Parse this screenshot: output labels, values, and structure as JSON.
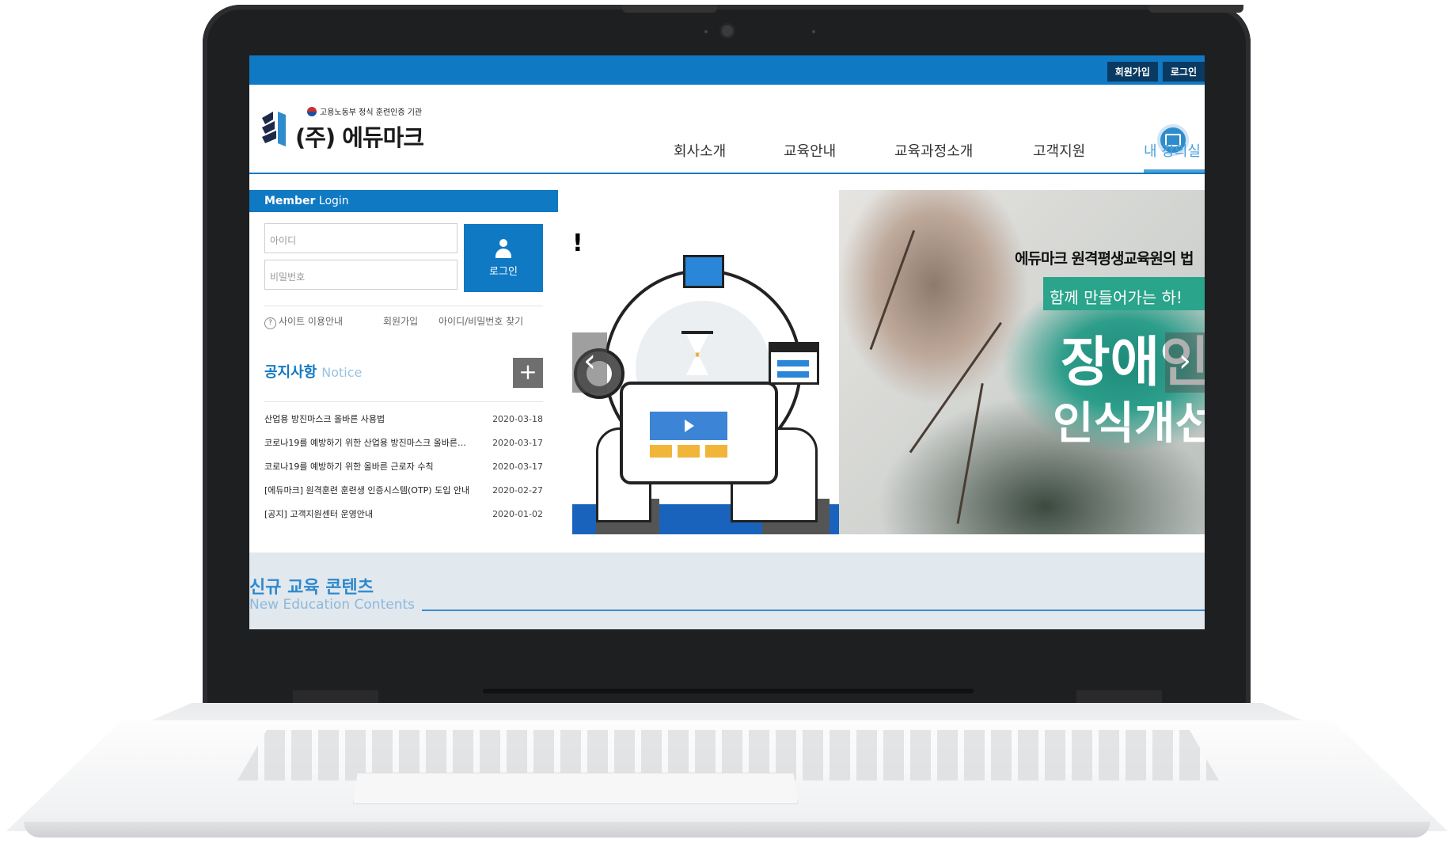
{
  "colors": {
    "brand_blue": "#1079c3",
    "accent_light": "#4aa0dc",
    "dark_navy": "#0a3a62"
  },
  "topbar": {
    "signup": "회원가입",
    "login": "로그인"
  },
  "logo": {
    "subtitle": "고용노동부 정식 훈련인증 기관",
    "name": "(주) 에듀마크"
  },
  "nav": {
    "items": [
      "회사소개",
      "교육안내",
      "교육과정소개",
      "고객지원",
      "내 강의실"
    ],
    "active_index": 4,
    "monitor_icon": "monitor-icon"
  },
  "login": {
    "title_bold": "Member",
    "title_rest": "Login",
    "id_placeholder": "아이디",
    "pw_placeholder": "비밀번호",
    "button": "로그인",
    "links": {
      "guide": "사이트 이용안내",
      "signup": "회원가입",
      "find": "아이디/비밀번호 찾기"
    }
  },
  "notice": {
    "title": "공지사항",
    "title_en": "Notice",
    "more_icon": "plus-icon",
    "items": [
      {
        "title": "산업용 방진마스크 올바른 사용법",
        "date": "2020-03-18"
      },
      {
        "title": "코로나19를 예방하기 위한 산업용 방진마스크 올바른…",
        "date": "2020-03-17"
      },
      {
        "title": "코로나19를 예방하기 위한 올바른 근로자 수칙",
        "date": "2020-03-17"
      },
      {
        "title": "[에듀마크] 원격훈련 훈련생 인증시스템(OTP) 도입 안내",
        "date": "2020-02-27"
      },
      {
        "title": "[공지] 고객지원센터 운영안내",
        "date": "2020-01-02"
      }
    ]
  },
  "banner": {
    "exclaim": "!",
    "headline": "에듀마크 원격평생교육원의 법",
    "subline": "함께 만들어가는 하!",
    "big1": "장애인",
    "big2": "인식개선",
    "prev_icon": "chevron-left-icon",
    "next_icon": "chevron-right-icon",
    "prev_glyph": "‹",
    "next_glyph": "›"
  },
  "new_contents": {
    "title": "신규 교육 콘텐츠",
    "subtitle": "New Education Contents"
  }
}
